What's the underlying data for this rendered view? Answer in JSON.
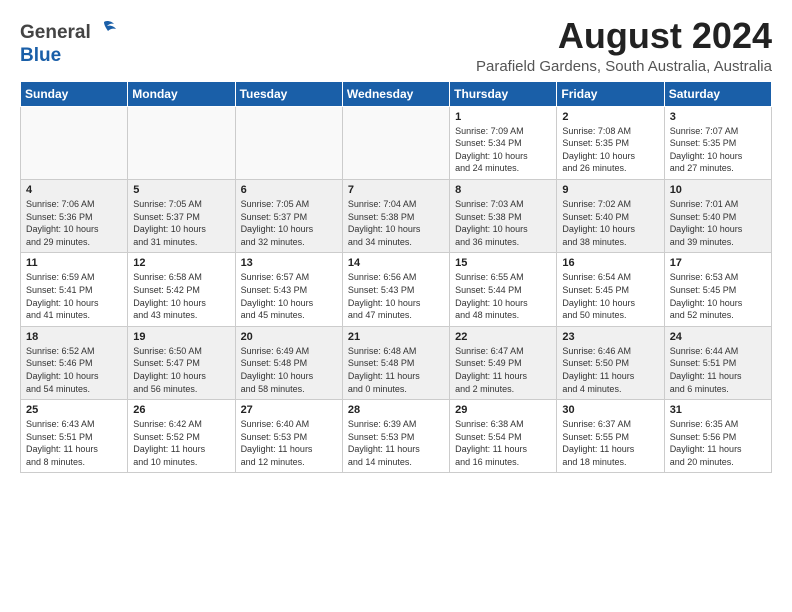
{
  "header": {
    "logo_general": "General",
    "logo_blue": "Blue",
    "month": "August 2024",
    "location": "Parafield Gardens, South Australia, Australia"
  },
  "weekdays": [
    "Sunday",
    "Monday",
    "Tuesday",
    "Wednesday",
    "Thursday",
    "Friday",
    "Saturday"
  ],
  "weeks": [
    [
      {
        "day": "",
        "info": ""
      },
      {
        "day": "",
        "info": ""
      },
      {
        "day": "",
        "info": ""
      },
      {
        "day": "",
        "info": ""
      },
      {
        "day": "1",
        "info": "Sunrise: 7:09 AM\nSunset: 5:34 PM\nDaylight: 10 hours\nand 24 minutes."
      },
      {
        "day": "2",
        "info": "Sunrise: 7:08 AM\nSunset: 5:35 PM\nDaylight: 10 hours\nand 26 minutes."
      },
      {
        "day": "3",
        "info": "Sunrise: 7:07 AM\nSunset: 5:35 PM\nDaylight: 10 hours\nand 27 minutes."
      }
    ],
    [
      {
        "day": "4",
        "info": "Sunrise: 7:06 AM\nSunset: 5:36 PM\nDaylight: 10 hours\nand 29 minutes."
      },
      {
        "day": "5",
        "info": "Sunrise: 7:05 AM\nSunset: 5:37 PM\nDaylight: 10 hours\nand 31 minutes."
      },
      {
        "day": "6",
        "info": "Sunrise: 7:05 AM\nSunset: 5:37 PM\nDaylight: 10 hours\nand 32 minutes."
      },
      {
        "day": "7",
        "info": "Sunrise: 7:04 AM\nSunset: 5:38 PM\nDaylight: 10 hours\nand 34 minutes."
      },
      {
        "day": "8",
        "info": "Sunrise: 7:03 AM\nSunset: 5:38 PM\nDaylight: 10 hours\nand 36 minutes."
      },
      {
        "day": "9",
        "info": "Sunrise: 7:02 AM\nSunset: 5:40 PM\nDaylight: 10 hours\nand 38 minutes."
      },
      {
        "day": "10",
        "info": "Sunrise: 7:01 AM\nSunset: 5:40 PM\nDaylight: 10 hours\nand 39 minutes."
      }
    ],
    [
      {
        "day": "11",
        "info": "Sunrise: 6:59 AM\nSunset: 5:41 PM\nDaylight: 10 hours\nand 41 minutes."
      },
      {
        "day": "12",
        "info": "Sunrise: 6:58 AM\nSunset: 5:42 PM\nDaylight: 10 hours\nand 43 minutes."
      },
      {
        "day": "13",
        "info": "Sunrise: 6:57 AM\nSunset: 5:43 PM\nDaylight: 10 hours\nand 45 minutes."
      },
      {
        "day": "14",
        "info": "Sunrise: 6:56 AM\nSunset: 5:43 PM\nDaylight: 10 hours\nand 47 minutes."
      },
      {
        "day": "15",
        "info": "Sunrise: 6:55 AM\nSunset: 5:44 PM\nDaylight: 10 hours\nand 48 minutes."
      },
      {
        "day": "16",
        "info": "Sunrise: 6:54 AM\nSunset: 5:45 PM\nDaylight: 10 hours\nand 50 minutes."
      },
      {
        "day": "17",
        "info": "Sunrise: 6:53 AM\nSunset: 5:45 PM\nDaylight: 10 hours\nand 52 minutes."
      }
    ],
    [
      {
        "day": "18",
        "info": "Sunrise: 6:52 AM\nSunset: 5:46 PM\nDaylight: 10 hours\nand 54 minutes."
      },
      {
        "day": "19",
        "info": "Sunrise: 6:50 AM\nSunset: 5:47 PM\nDaylight: 10 hours\nand 56 minutes."
      },
      {
        "day": "20",
        "info": "Sunrise: 6:49 AM\nSunset: 5:48 PM\nDaylight: 10 hours\nand 58 minutes."
      },
      {
        "day": "21",
        "info": "Sunrise: 6:48 AM\nSunset: 5:48 PM\nDaylight: 11 hours\nand 0 minutes."
      },
      {
        "day": "22",
        "info": "Sunrise: 6:47 AM\nSunset: 5:49 PM\nDaylight: 11 hours\nand 2 minutes."
      },
      {
        "day": "23",
        "info": "Sunrise: 6:46 AM\nSunset: 5:50 PM\nDaylight: 11 hours\nand 4 minutes."
      },
      {
        "day": "24",
        "info": "Sunrise: 6:44 AM\nSunset: 5:51 PM\nDaylight: 11 hours\nand 6 minutes."
      }
    ],
    [
      {
        "day": "25",
        "info": "Sunrise: 6:43 AM\nSunset: 5:51 PM\nDaylight: 11 hours\nand 8 minutes."
      },
      {
        "day": "26",
        "info": "Sunrise: 6:42 AM\nSunset: 5:52 PM\nDaylight: 11 hours\nand 10 minutes."
      },
      {
        "day": "27",
        "info": "Sunrise: 6:40 AM\nSunset: 5:53 PM\nDaylight: 11 hours\nand 12 minutes."
      },
      {
        "day": "28",
        "info": "Sunrise: 6:39 AM\nSunset: 5:53 PM\nDaylight: 11 hours\nand 14 minutes."
      },
      {
        "day": "29",
        "info": "Sunrise: 6:38 AM\nSunset: 5:54 PM\nDaylight: 11 hours\nand 16 minutes."
      },
      {
        "day": "30",
        "info": "Sunrise: 6:37 AM\nSunset: 5:55 PM\nDaylight: 11 hours\nand 18 minutes."
      },
      {
        "day": "31",
        "info": "Sunrise: 6:35 AM\nSunset: 5:56 PM\nDaylight: 11 hours\nand 20 minutes."
      }
    ]
  ]
}
